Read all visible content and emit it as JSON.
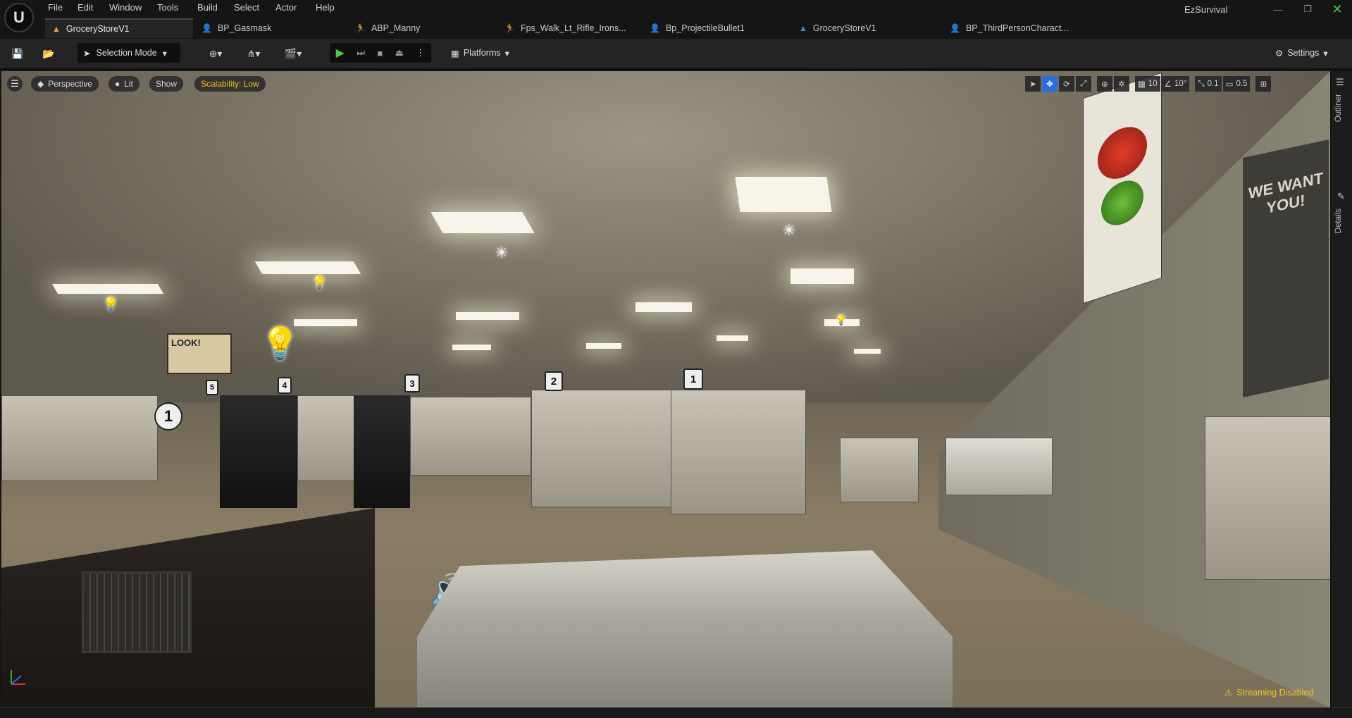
{
  "menu": [
    "File",
    "Edit",
    "Window",
    "Tools",
    "Build",
    "Select",
    "Actor",
    "Help"
  ],
  "project_name": "EzSurvival",
  "tabs": [
    {
      "label": "GroceryStoreV1",
      "icon": "level-icon",
      "active": true
    },
    {
      "label": "BP_Gasmask",
      "icon": "blueprint-icon",
      "active": false
    },
    {
      "label": "ABP_Manny",
      "icon": "anim-blueprint-icon",
      "active": false
    },
    {
      "label": "Fps_Walk_Lt_Rifle_Irons...",
      "icon": "animation-icon",
      "active": false
    },
    {
      "label": "Bp_ProjectileBullet1",
      "icon": "blueprint-icon",
      "active": false
    },
    {
      "label": "GroceryStoreV1",
      "icon": "level-icon",
      "active": false
    },
    {
      "label": "BP_ThirdPersonCharact...",
      "icon": "blueprint-icon",
      "active": false
    }
  ],
  "toolbar": {
    "selection_mode": "Selection Mode",
    "platforms": "Platforms",
    "settings": "Settings"
  },
  "viewport": {
    "perspective": "Perspective",
    "lit": "Lit",
    "show": "Show",
    "scalability": "Scalability: Low",
    "grid_snap": "10",
    "rotation_snap": "10°",
    "scale_snap": "0.1",
    "camera_speed": "0.5",
    "streaming": "Streaming Disabled",
    "aisle_numbers": [
      "1",
      "5",
      "4",
      "3",
      "2",
      "1"
    ],
    "poster_text": "WE WANT YOU!",
    "poster_look": "LOOK!"
  },
  "side_panel": {
    "outliner": "Outliner",
    "details": "Details"
  },
  "colors": {
    "accent_blue": "#2a6fdb",
    "warning_yellow": "#f1c21b",
    "play_green": "#4cc74c"
  }
}
